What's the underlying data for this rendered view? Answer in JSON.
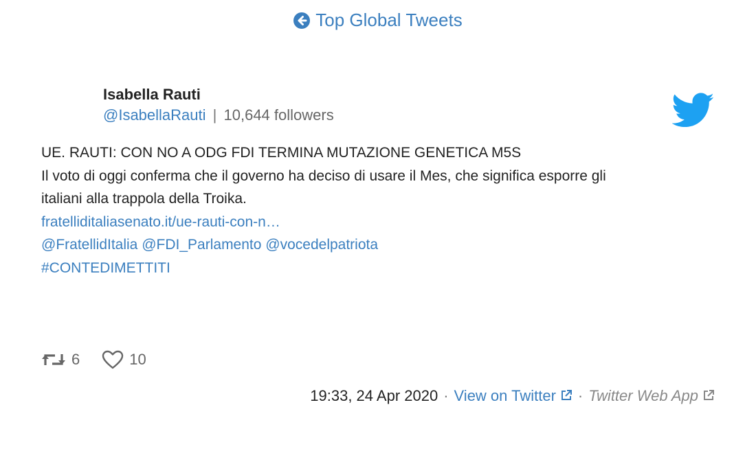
{
  "nav": {
    "back_label": "Top Global Tweets"
  },
  "tweet": {
    "author_name": "Isabella Rauti",
    "handle": "@IsabellaRauti",
    "separator": "|",
    "followers": "10,644 followers",
    "lines": [
      "UE. RAUTI: CON NO A ODG FDI TERMINA MUTAZIONE GENETICA M5S",
      "Il voto di oggi conferma che il governo ha deciso di usare il Mes, che significa esporre gli",
      "italiani alla trappola della Troika."
    ],
    "link": "fratelliditaliasenato.it/ue-rauti-con-n…",
    "mentions": [
      "@FratellidItalia",
      "@FDI_Parlamento",
      "@vocedelpatriota"
    ],
    "hashtag": "#CONTEDIMETTITI",
    "retweets": "6",
    "likes": "10",
    "timestamp": "19:33, 24 Apr 2020",
    "view_on_twitter": "View on Twitter",
    "source": "Twitter Web App",
    "dot": "·"
  },
  "colors": {
    "link": "#3b7fbf",
    "twitter_blue": "#1da1f2",
    "muted": "#666666"
  },
  "icons": {
    "back": "circle-arrow-left-icon",
    "bird": "twitter-bird-icon",
    "retweet": "retweet-icon",
    "like": "heart-icon",
    "external": "external-link-icon"
  }
}
